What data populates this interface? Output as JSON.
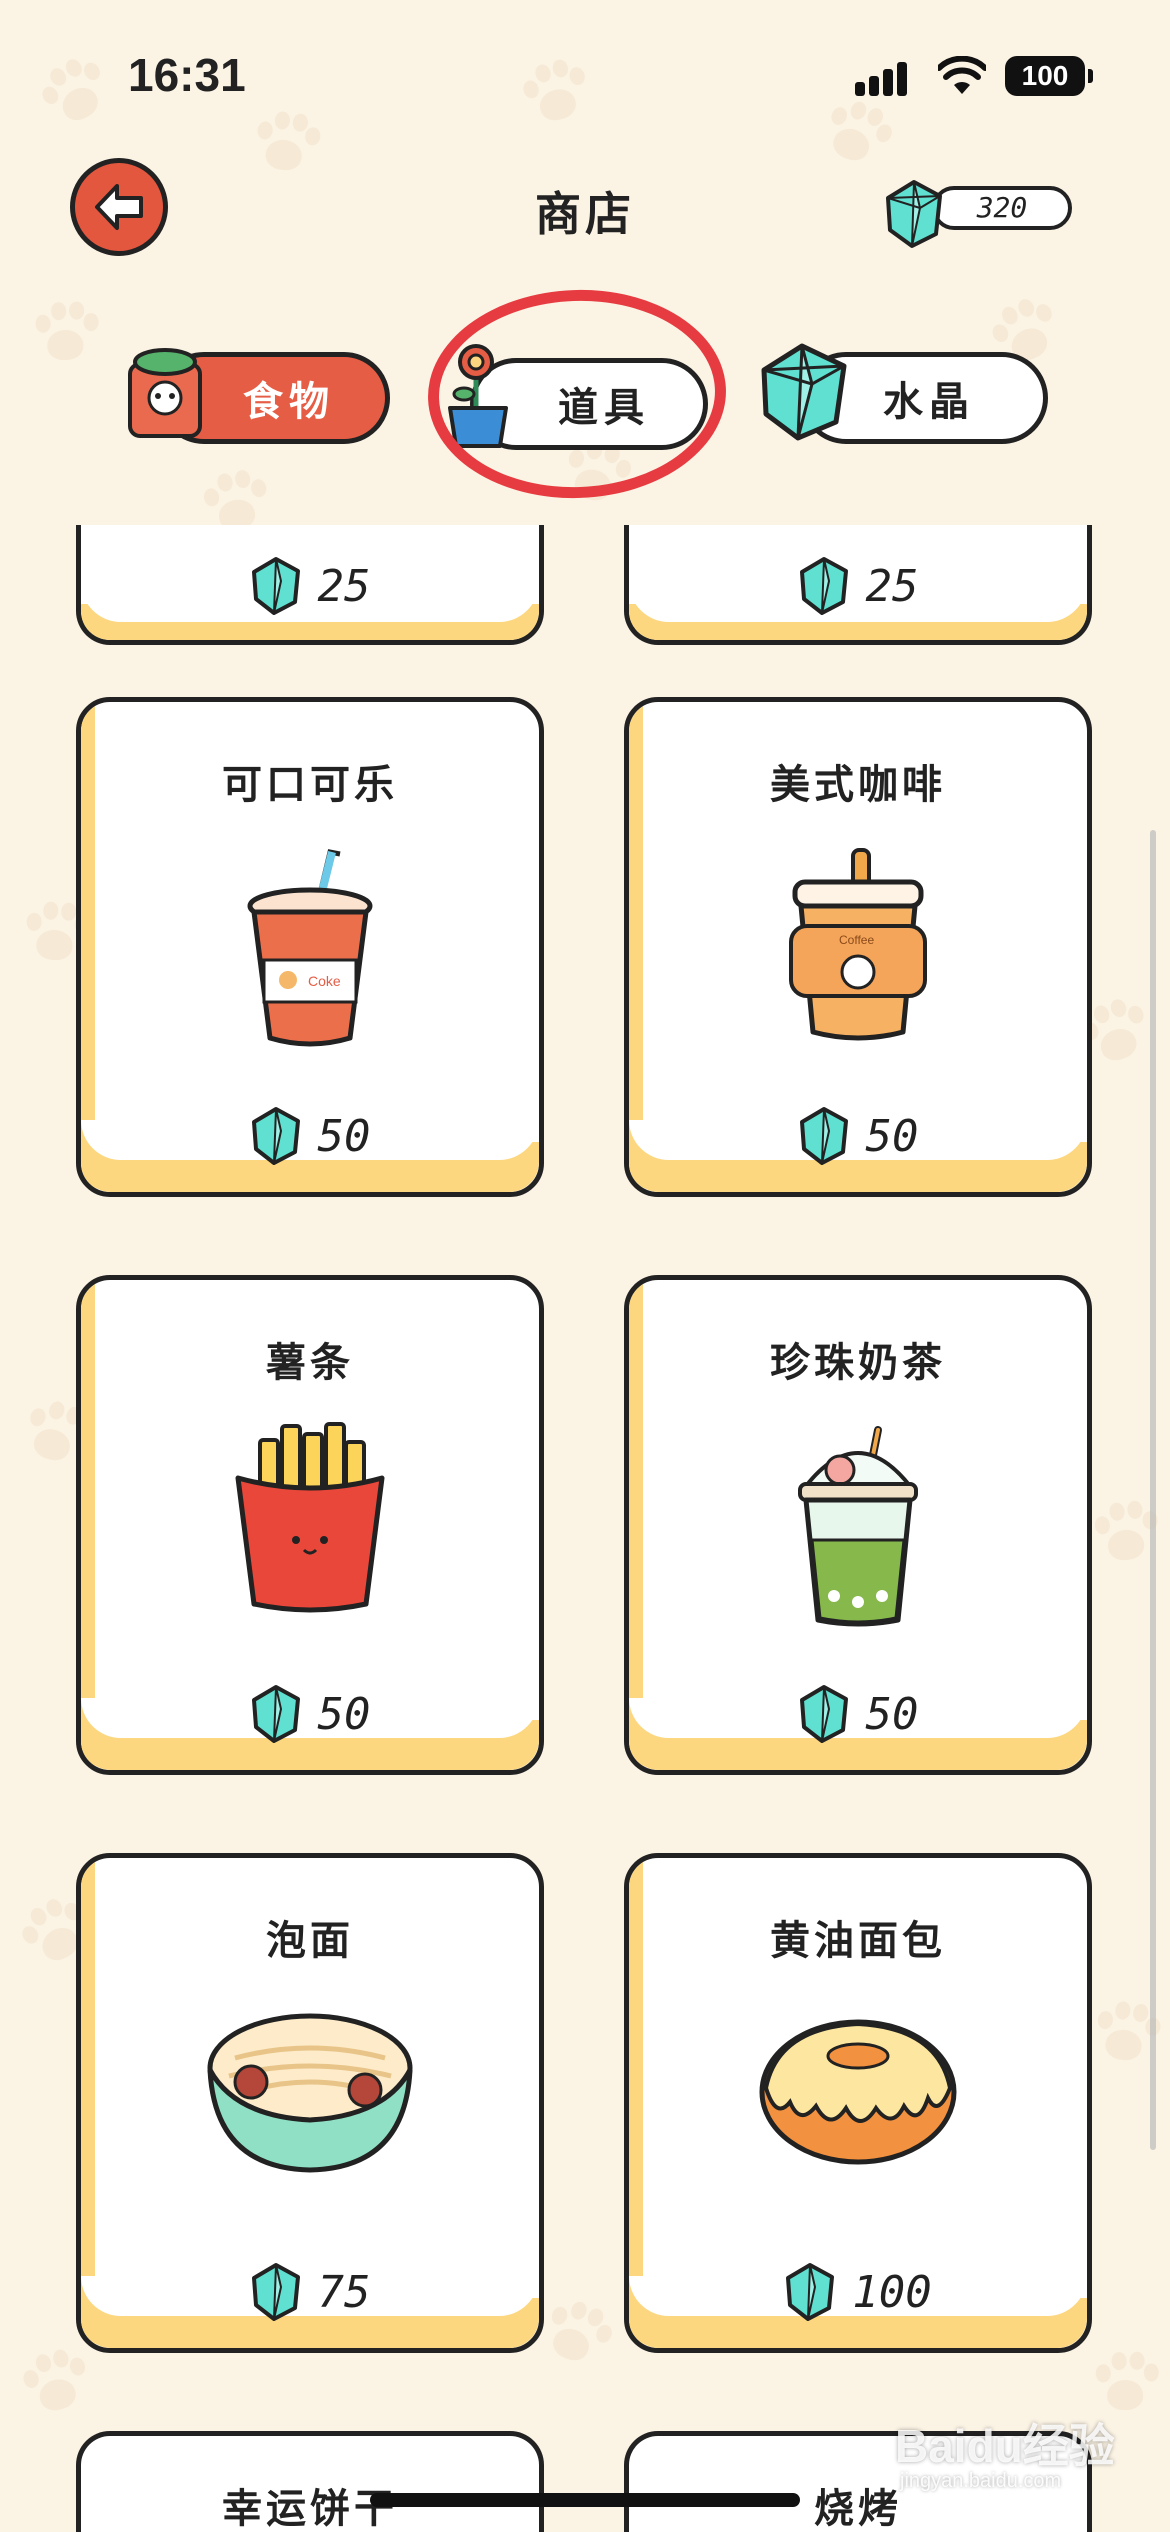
{
  "status_bar": {
    "time": "16:31",
    "battery": "100"
  },
  "header": {
    "title": "商店",
    "gem_count": "320"
  },
  "tabs": [
    {
      "label": "食物",
      "active": true
    },
    {
      "label": "道具",
      "active": false
    },
    {
      "label": "水晶",
      "active": false
    }
  ],
  "colors": {
    "accent": "#e65d45",
    "card_trim": "#fcd77f",
    "gem": "#5fe0d1",
    "annotation": "#e63c41"
  },
  "partial_top_items": [
    {
      "price": "25"
    },
    {
      "price": "25"
    }
  ],
  "items": [
    {
      "name": "可口可乐",
      "price": "50",
      "icon": "cola-cup-icon"
    },
    {
      "name": "美式咖啡",
      "price": "50",
      "icon": "coffee-cup-icon"
    },
    {
      "name": "薯条",
      "price": "50",
      "icon": "fries-icon"
    },
    {
      "name": "珍珠奶茶",
      "price": "50",
      "icon": "bubble-tea-icon"
    },
    {
      "name": "泡面",
      "price": "75",
      "icon": "noodle-bowl-icon"
    },
    {
      "name": "黄油面包",
      "price": "100",
      "icon": "butter-bread-icon"
    }
  ],
  "partial_bottom_items": [
    {
      "name": "幸运饼干"
    },
    {
      "name": "烧烤"
    }
  ],
  "watermark": {
    "brand": "Baidu经验",
    "url": "jingyan.baidu.com"
  }
}
